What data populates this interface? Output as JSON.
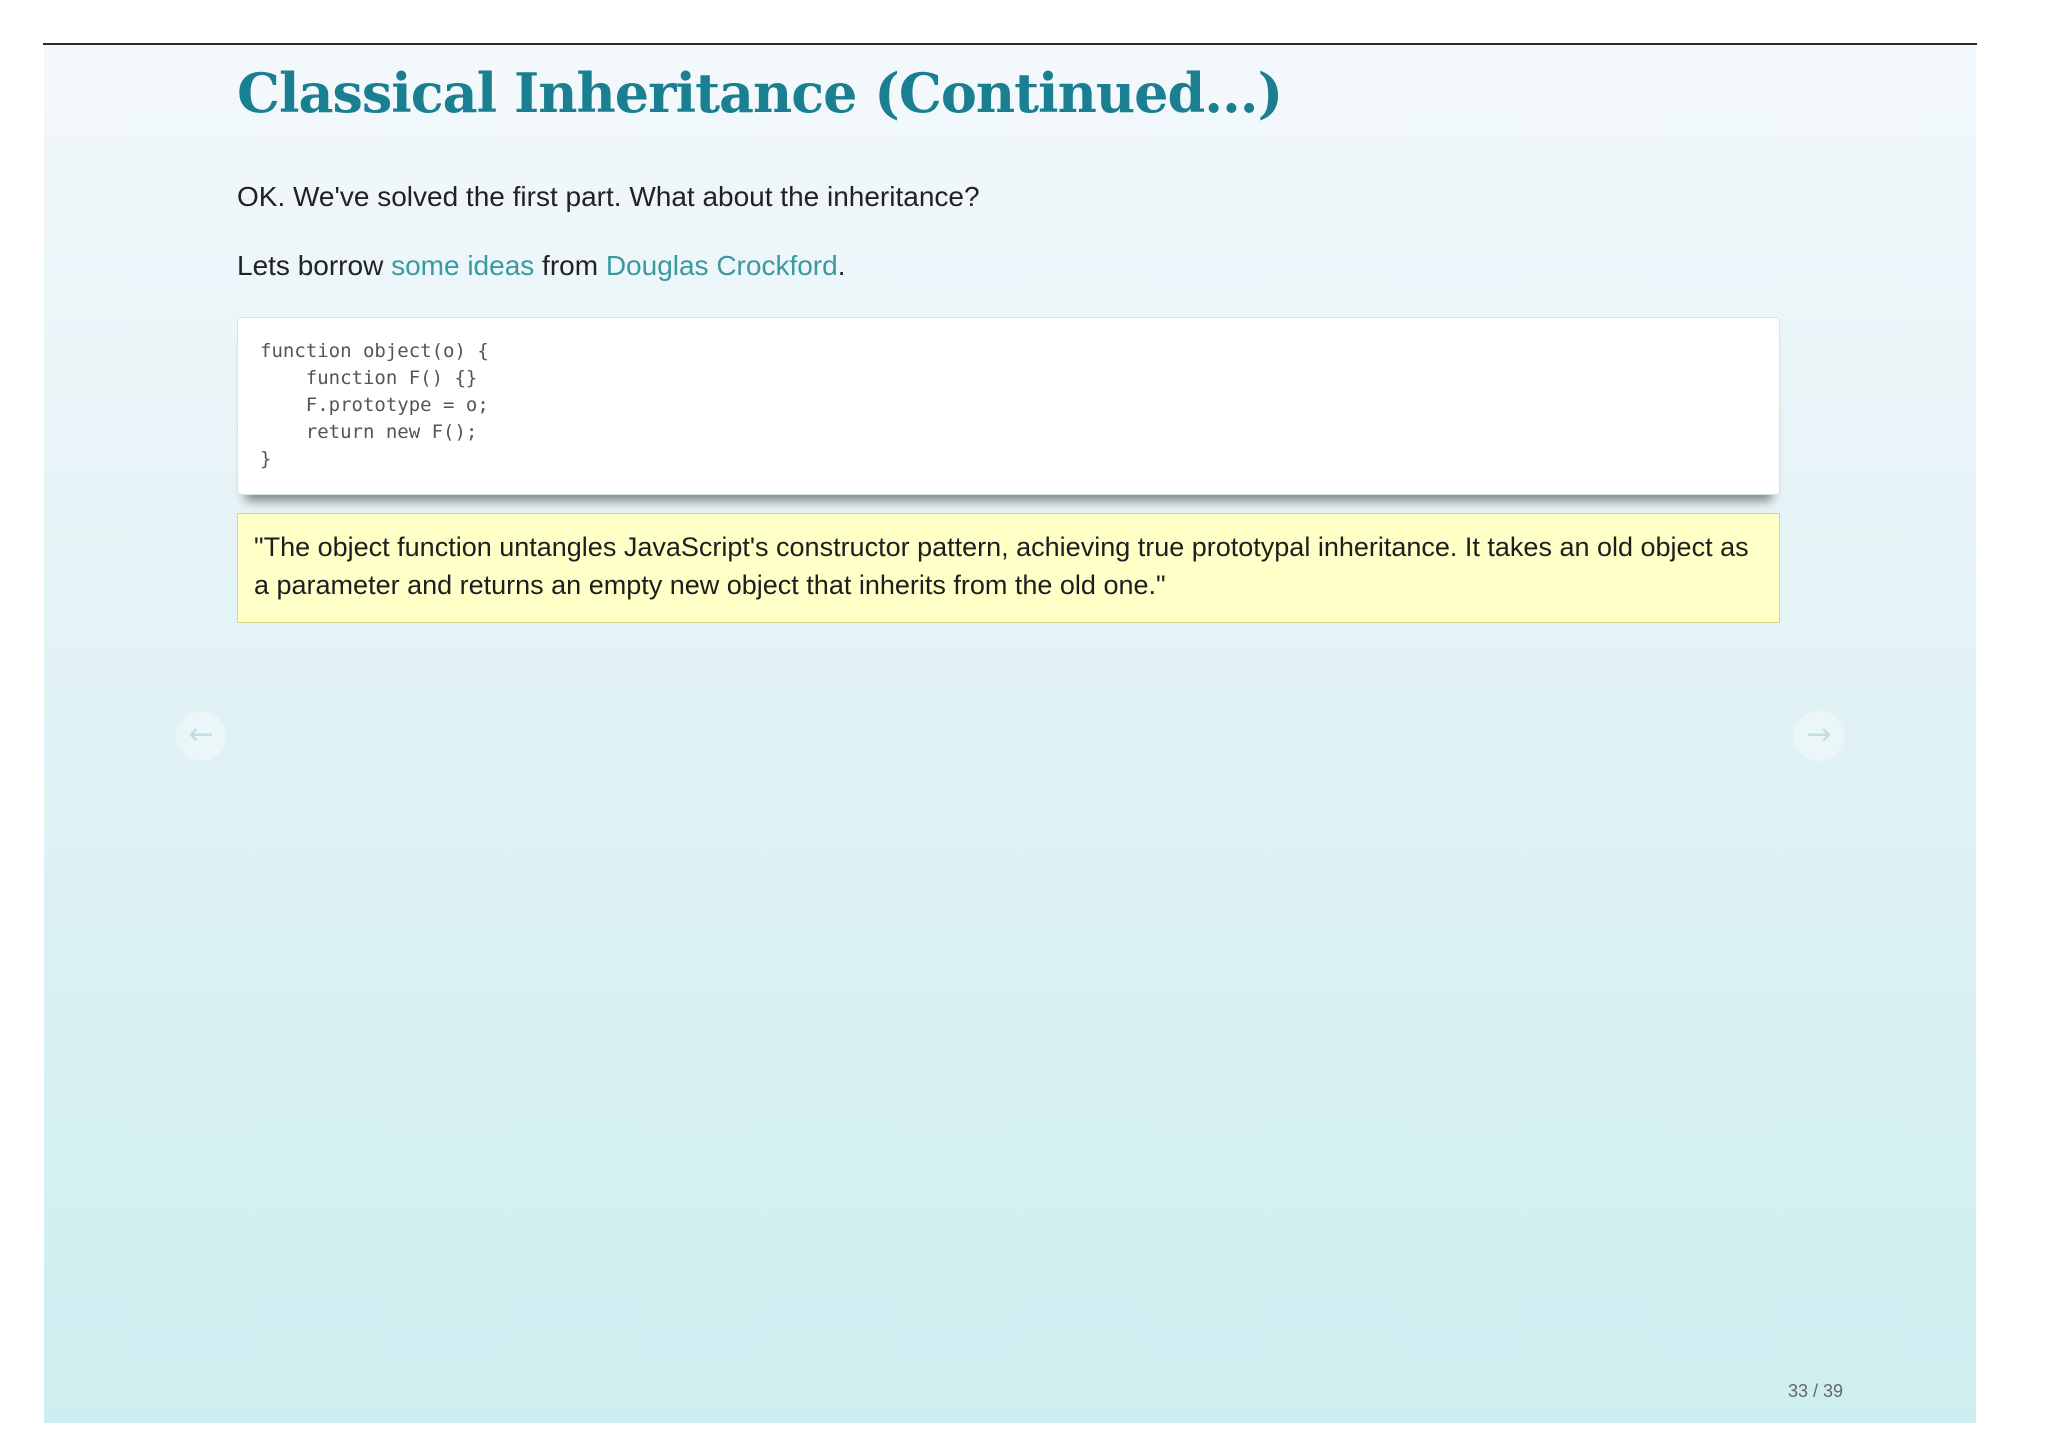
{
  "slide": {
    "title": "Classical Inheritance (Continued...)",
    "paragraph1": "OK. We've solved the first part. What about the inheritance?",
    "paragraph2": {
      "prefix": "Lets borrow ",
      "link1": "some ideas",
      "middle": " from ",
      "link2": "Douglas Crockford",
      "suffix": "."
    },
    "code": "function object(o) {\n    function F() {}\n    F.prototype = o;\n    return new F();\n}",
    "quote": "\"The object function untangles JavaScript's constructor pattern, achieving true prototypal inheritance. It takes an old object as a parameter and returns an empty new object that inherits from the old one.\""
  },
  "navigation": {
    "prev_icon": "left-arrow-icon",
    "prev_glyph": "←",
    "next_icon": "right-arrow-icon",
    "next_glyph": "→"
  },
  "counter": {
    "current": "33",
    "separator": " / ",
    "total": "39"
  },
  "colors": {
    "title": "#1a7f91",
    "link": "#3a9aa0",
    "quote_background": "#ffffc8"
  }
}
